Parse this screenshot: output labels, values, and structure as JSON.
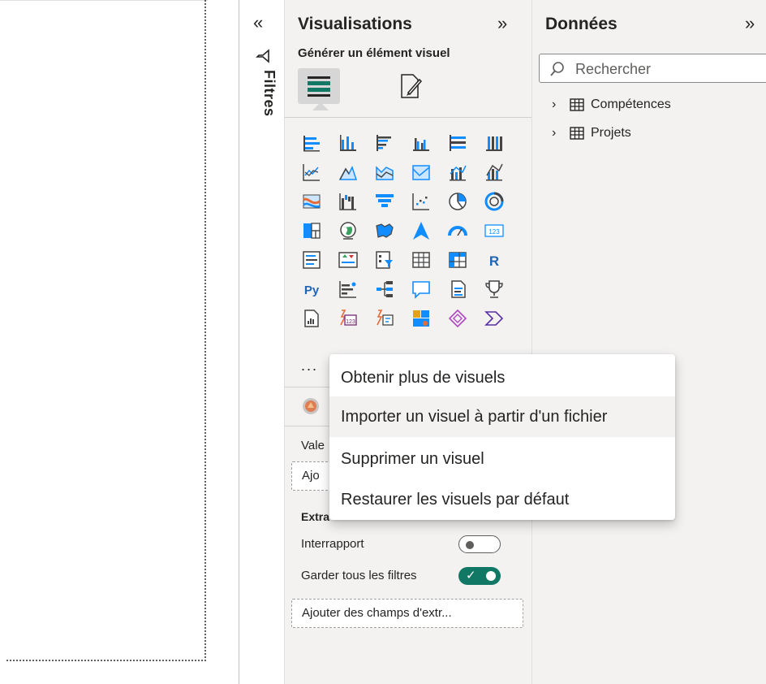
{
  "filters_pane": {
    "label": "Filtres",
    "collapse_icon": "double-chevron-left-icon",
    "funnel_icon": "funnel-icon"
  },
  "visualisations": {
    "title": "Visualisations",
    "expand_icon": "double-chevron-right-icon",
    "build_label": "Générer un élément visuel",
    "more_label": "...",
    "fields": {
      "values_label": "Vale",
      "values_placeholder": "Ajo"
    },
    "drillthrough": {
      "section_label": "Extra",
      "cross_report_label": "Interrapport",
      "cross_report_on": false,
      "keep_filters_label": "Garder tous les filtres",
      "keep_filters_on": true,
      "add_fields_label": "Ajouter des champs d'extr..."
    },
    "gallery_icons": [
      "stacked-bar-chart-icon",
      "stacked-column-chart-icon",
      "clustered-bar-chart-icon",
      "clustered-column-chart-icon",
      "100-stacked-bar-chart-icon",
      "100-stacked-column-chart-icon",
      "line-chart-icon",
      "area-chart-icon",
      "stacked-area-chart-icon",
      "100-stacked-area-chart-icon",
      "line-and-stacked-column-chart-icon",
      "line-and-clustered-column-chart-icon",
      "ribbon-chart-icon",
      "waterfall-chart-icon",
      "funnel-chart-icon",
      "scatter-chart-icon",
      "pie-chart-icon",
      "donut-chart-icon",
      "treemap-icon",
      "map-icon",
      "filled-map-icon",
      "azure-map-icon",
      "gauge-icon",
      "card-icon",
      "multi-row-card-icon",
      "kpi-icon",
      "slicer-icon",
      "table-icon",
      "matrix-icon",
      "r-script-visual-icon",
      "python-visual-icon",
      "key-influencers-icon",
      "decomposition-tree-icon",
      "qa-icon",
      "smart-narrative-icon",
      "metrics-icon",
      "paginated-report-icon",
      "power-apps-icon",
      "power-automate-icon",
      "arcgis-map-icon",
      "custom-visual-diamond-icon",
      "custom-visual-chevron-icon"
    ]
  },
  "data_pane": {
    "title": "Données",
    "expand_icon": "double-chevron-right-icon",
    "search_placeholder": "Rechercher",
    "tables": [
      {
        "name": "Compétences"
      },
      {
        "name": "Projets"
      }
    ]
  },
  "context_menu": {
    "items": [
      {
        "label": "Obtenir plus de visuels",
        "hovered": false
      },
      {
        "label": "Importer un visuel à partir d'un fichier",
        "hovered": true
      },
      {
        "label": "Supprimer un visuel",
        "hovered": false
      },
      {
        "label": "Restaurer les visuels par défaut",
        "hovered": false
      }
    ]
  },
  "colors": {
    "accent_teal": "#117865",
    "chart_blue": "#1f77b4",
    "pane_bg": "#f3f2f1"
  }
}
